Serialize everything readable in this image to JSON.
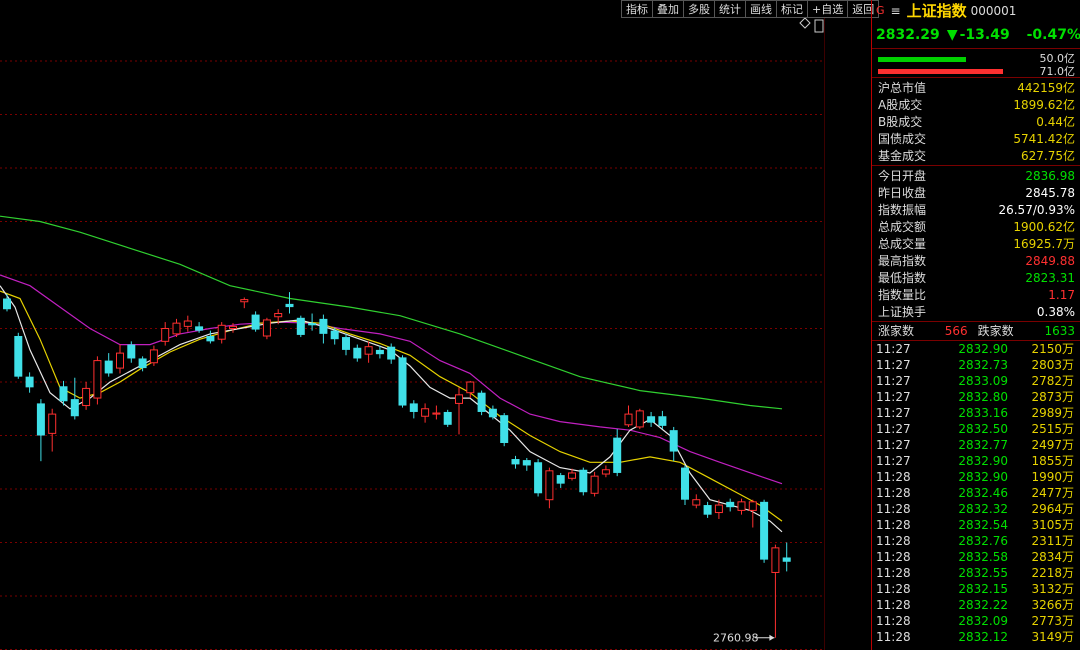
{
  "toolbar": [
    "指标",
    "叠加",
    "多股",
    "统计",
    "画线",
    "标记",
    "+自选",
    "返回"
  ],
  "chart_data": {
    "type": "candlestick",
    "y_ticks": [
      3300,
      3275,
      3250,
      3225,
      3200,
      3175,
      3150,
      3125,
      3100,
      3075,
      3050,
      3025,
      3000,
      2975,
      2950,
      2925,
      2900,
      2875,
      2850,
      2825,
      2800,
      2775,
      2750
    ],
    "price_marker": "3115.6",
    "low_annotation": "2760.98",
    "candles": [
      [
        3078,
        3068,
        3082,
        3066
      ],
      [
        3043,
        3005,
        3046,
        3003
      ],
      [
        3005,
        2995,
        3009,
        2990
      ],
      [
        2980,
        2950,
        2984,
        2926
      ],
      [
        2952,
        2970,
        2975,
        2935
      ],
      [
        2996,
        2982,
        3001,
        2978
      ],
      [
        2984,
        2968,
        3004,
        2965
      ],
      [
        2978,
        2994,
        3000,
        2974
      ],
      [
        2985,
        3020,
        3024,
        2979
      ],
      [
        3020,
        3008,
        3027,
        3005
      ],
      [
        3013,
        3027,
        3035,
        3008
      ],
      [
        3035,
        3022,
        3038,
        3018
      ],
      [
        3022,
        3013,
        3024,
        3010
      ],
      [
        3018,
        3030,
        3034,
        3015
      ],
      [
        3038,
        3050,
        3056,
        3034
      ],
      [
        3045,
        3055,
        3059,
        3042
      ],
      [
        3052,
        3057,
        3062,
        3047
      ],
      [
        3052,
        3048,
        3056,
        3046
      ],
      [
        3043,
        3038,
        3048,
        3036
      ],
      [
        3040,
        3053,
        3056,
        3036
      ],
      [
        3050,
        3052,
        3055,
        3046
      ],
      [
        3075,
        3077,
        3079,
        3069
      ],
      [
        3063,
        3049,
        3066,
        3047
      ],
      [
        3043,
        3058,
        3060,
        3040
      ],
      [
        3061,
        3064,
        3068,
        3054
      ],
      [
        3073,
        3070,
        3084,
        3064
      ],
      [
        3060,
        3044,
        3062,
        3042
      ],
      [
        3055,
        3053,
        3064,
        3048
      ],
      [
        3059,
        3045,
        3063,
        3036
      ],
      [
        3048,
        3040,
        3051,
        3035
      ],
      [
        3042,
        3030,
        3045,
        3025
      ],
      [
        3032,
        3022,
        3035,
        3019
      ],
      [
        3026,
        3033,
        3038,
        3018
      ],
      [
        3030,
        3026,
        3034,
        3022
      ],
      [
        3033,
        3021,
        3036,
        3017
      ],
      [
        3023,
        2978,
        3025,
        2976
      ],
      [
        2980,
        2972,
        2983,
        2966
      ],
      [
        2968,
        2975,
        2980,
        2962
      ],
      [
        2970,
        2971,
        2978,
        2965
      ],
      [
        2972,
        2960,
        2974,
        2958
      ],
      [
        2980,
        2988,
        2995,
        2951
      ],
      [
        2990,
        3000,
        3001,
        2985
      ],
      [
        2990,
        2972,
        2992,
        2969
      ],
      [
        2975,
        2967,
        2978,
        2965
      ],
      [
        2969,
        2943,
        2971,
        2940
      ],
      [
        2928,
        2923,
        2931,
        2919
      ],
      [
        2927,
        2922,
        2929,
        2917
      ],
      [
        2925,
        2896,
        2928,
        2893
      ],
      [
        2890,
        2917,
        2920,
        2882
      ],
      [
        2913,
        2905,
        2915,
        2901
      ],
      [
        2910,
        2915,
        2919,
        2908
      ],
      [
        2918,
        2897,
        2920,
        2894
      ],
      [
        2896,
        2912,
        2916,
        2893
      ],
      [
        2914,
        2918,
        2922,
        2911
      ],
      [
        2948,
        2915,
        2956,
        2912
      ],
      [
        2960,
        2970,
        2978,
        2958
      ],
      [
        2958,
        2973,
        2975,
        2956
      ],
      [
        2968,
        2962,
        2972,
        2958
      ],
      [
        2968,
        2959,
        2973,
        2956
      ],
      [
        2955,
        2935,
        2958,
        2926
      ],
      [
        2920,
        2890,
        2922,
        2885
      ],
      [
        2885,
        2890,
        2895,
        2882
      ],
      [
        2885,
        2876,
        2888,
        2873
      ],
      [
        2878,
        2885,
        2890,
        2872
      ],
      [
        2888,
        2883,
        2891,
        2879
      ],
      [
        2880,
        2888,
        2891,
        2876
      ],
      [
        2880,
        2888,
        2890,
        2864
      ],
      [
        2888,
        2834,
        2890,
        2831
      ],
      [
        2822,
        2845,
        2848,
        2761
      ],
      [
        2836,
        2832,
        2850,
        2823
      ]
    ],
    "ma_green": [
      [
        0,
        3155
      ],
      [
        40,
        3150
      ],
      [
        80,
        3140
      ],
      [
        130,
        3125
      ],
      [
        180,
        3110
      ],
      [
        230,
        3090
      ],
      [
        290,
        3078
      ],
      [
        350,
        3070
      ],
      [
        400,
        3062
      ],
      [
        460,
        3045
      ],
      [
        520,
        3025
      ],
      [
        580,
        3005
      ],
      [
        640,
        2992
      ],
      [
        700,
        2985
      ],
      [
        750,
        2978
      ],
      [
        782,
        2975
      ]
    ],
    "ma_magenta": [
      [
        0,
        3100
      ],
      [
        30,
        3090
      ],
      [
        60,
        3070
      ],
      [
        90,
        3050
      ],
      [
        120,
        3035
      ],
      [
        150,
        3035
      ],
      [
        180,
        3045
      ],
      [
        210,
        3050
      ],
      [
        240,
        3054
      ],
      [
        280,
        3056
      ],
      [
        310,
        3055
      ],
      [
        340,
        3050
      ],
      [
        380,
        3045
      ],
      [
        410,
        3038
      ],
      [
        440,
        3020
      ],
      [
        470,
        3008
      ],
      [
        500,
        2985
      ],
      [
        530,
        2970
      ],
      [
        560,
        2963
      ],
      [
        600,
        2958
      ],
      [
        630,
        2955
      ],
      [
        660,
        2948
      ],
      [
        690,
        2935
      ],
      [
        720,
        2925
      ],
      [
        760,
        2912
      ],
      [
        782,
        2905
      ]
    ],
    "ma_yellow": [
      [
        0,
        3085
      ],
      [
        20,
        3078
      ],
      [
        40,
        3040
      ],
      [
        60,
        2995
      ],
      [
        80,
        2985
      ],
      [
        100,
        2990
      ],
      [
        120,
        3000
      ],
      [
        140,
        3012
      ],
      [
        170,
        3028
      ],
      [
        200,
        3040
      ],
      [
        230,
        3048
      ],
      [
        260,
        3055
      ],
      [
        290,
        3057
      ],
      [
        320,
        3055
      ],
      [
        350,
        3045
      ],
      [
        380,
        3036
      ],
      [
        410,
        3025
      ],
      [
        440,
        3005
      ],
      [
        470,
        2990
      ],
      [
        500,
        2968
      ],
      [
        530,
        2950
      ],
      [
        560,
        2935
      ],
      [
        590,
        2925
      ],
      [
        620,
        2925
      ],
      [
        650,
        2930
      ],
      [
        680,
        2925
      ],
      [
        710,
        2910
      ],
      [
        740,
        2895
      ],
      [
        760,
        2885
      ],
      [
        782,
        2870
      ]
    ],
    "ma_white": [
      [
        0,
        3090
      ],
      [
        15,
        3070
      ],
      [
        30,
        3030
      ],
      [
        50,
        2990
      ],
      [
        70,
        2975
      ],
      [
        90,
        2985
      ],
      [
        110,
        3000
      ],
      [
        130,
        3010
      ],
      [
        150,
        3020
      ],
      [
        180,
        3035
      ],
      [
        210,
        3045
      ],
      [
        240,
        3050
      ],
      [
        270,
        3055
      ],
      [
        300,
        3058
      ],
      [
        330,
        3050
      ],
      [
        360,
        3040
      ],
      [
        390,
        3030
      ],
      [
        410,
        3015
      ],
      [
        430,
        2995
      ],
      [
        450,
        2985
      ],
      [
        470,
        2985
      ],
      [
        490,
        2970
      ],
      [
        510,
        2955
      ],
      [
        530,
        2935
      ],
      [
        560,
        2920
      ],
      [
        590,
        2915
      ],
      [
        610,
        2930
      ],
      [
        630,
        2955
      ],
      [
        650,
        2965
      ],
      [
        670,
        2950
      ],
      [
        690,
        2915
      ],
      [
        710,
        2890
      ],
      [
        730,
        2885
      ],
      [
        750,
        2880
      ],
      [
        770,
        2870
      ],
      [
        782,
        2860
      ]
    ]
  },
  "colors": {
    "up": "#ff3030",
    "down": "#40e0e8",
    "grid": "#7a0000",
    "ma_green": "#30d030",
    "ma_magenta": "#c020c0",
    "ma_yellow": "#e6d200",
    "ma_white": "#e8e8e8"
  },
  "panel": {
    "g_icon": "G",
    "menu_icon": "≡",
    "name": "上证指数",
    "code": "000001",
    "price": "2832.29",
    "arrow": "▼",
    "change": "-13.49",
    "pct": "-0.47%",
    "bar1_label": "50.0亿",
    "bar1_frac": 0.55,
    "bar2_label": "71.0亿",
    "bar2_frac": 0.78,
    "stats1": [
      {
        "label": "沪总市值",
        "value": "442159亿"
      },
      {
        "label": "A股成交",
        "value": "1899.62亿"
      },
      {
        "label": "B股成交",
        "value": "0.44亿"
      },
      {
        "label": "国债成交",
        "value": "5741.42亿"
      },
      {
        "label": "基金成交",
        "value": "627.75亿"
      }
    ],
    "stats2": [
      {
        "label": "今日开盘",
        "value": "2836.98"
      },
      {
        "label": "昨日收盘",
        "value": "2845.78"
      },
      {
        "label": "指数振幅",
        "value": "26.57/0.93%"
      },
      {
        "label": "总成交额",
        "value": "1900.62亿"
      },
      {
        "label": "总成交量",
        "value": "16925.7万"
      },
      {
        "label": "最高指数",
        "value": "2849.88"
      },
      {
        "label": "最低指数",
        "value": "2823.31"
      },
      {
        "label": "指数量比",
        "value": "1.17"
      },
      {
        "label": "上证换手",
        "value": "0.38%"
      }
    ],
    "up_label": "涨家数",
    "up_count": "566",
    "down_label": "跌家数",
    "down_count": "1633",
    "ticks": [
      [
        "11:27",
        "2832.90",
        "2150万"
      ],
      [
        "11:27",
        "2832.73",
        "2803万"
      ],
      [
        "11:27",
        "2833.09",
        "2782万"
      ],
      [
        "11:27",
        "2832.80",
        "2873万"
      ],
      [
        "11:27",
        "2833.16",
        "2989万"
      ],
      [
        "11:27",
        "2832.50",
        "2515万"
      ],
      [
        "11:27",
        "2832.77",
        "2497万"
      ],
      [
        "11:27",
        "2832.90",
        "1855万"
      ],
      [
        "11:28",
        "2832.90",
        "1990万"
      ],
      [
        "11:28",
        "2832.46",
        "2477万"
      ],
      [
        "11:28",
        "2832.32",
        "2964万"
      ],
      [
        "11:28",
        "2832.54",
        "3105万"
      ],
      [
        "11:28",
        "2832.76",
        "2311万"
      ],
      [
        "11:28",
        "2832.58",
        "2834万"
      ],
      [
        "11:28",
        "2832.55",
        "2218万"
      ],
      [
        "11:28",
        "2832.15",
        "3132万"
      ],
      [
        "11:28",
        "2832.22",
        "3266万"
      ],
      [
        "11:28",
        "2832.09",
        "2773万"
      ],
      [
        "11:28",
        "2832.12",
        "3149万"
      ]
    ]
  }
}
